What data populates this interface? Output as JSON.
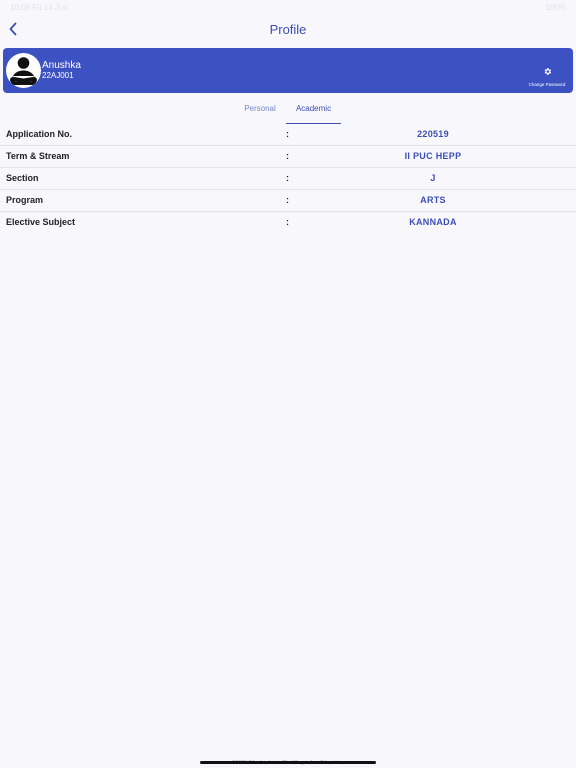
{
  "status_bar": {
    "time": "10:09   Fri 14 Jun",
    "battery": "100%"
  },
  "nav": {
    "title": "Profile",
    "back_icon": "chevron-left-icon"
  },
  "profile": {
    "name": "Anushka",
    "id": "22AJ001",
    "avatar_icon": "student-avatar-icon",
    "change_password_icon": "gear-icon",
    "change_password_label": "Change Password"
  },
  "tabs": [
    {
      "label": "Personal",
      "selected": false
    },
    {
      "label": "Academic",
      "selected": true
    }
  ],
  "academic": {
    "separator": ":",
    "rows": [
      {
        "label": "Application No.",
        "value": "220519"
      },
      {
        "label": "Term & Stream",
        "value": "II PUC HEPP"
      },
      {
        "label": "Section",
        "value": "J"
      },
      {
        "label": "Program",
        "value": "ARTS"
      },
      {
        "label": "Elective Subject",
        "value": "KANNADA"
      }
    ]
  },
  "footer": {
    "copyright": "©2023-24",
    "brand": "schoolmate",
    "tagline": "The Wings of an Education."
  },
  "colors": {
    "accent": "#3d4fb5",
    "card": "#3d52c2",
    "background": "#f7f7fc"
  }
}
